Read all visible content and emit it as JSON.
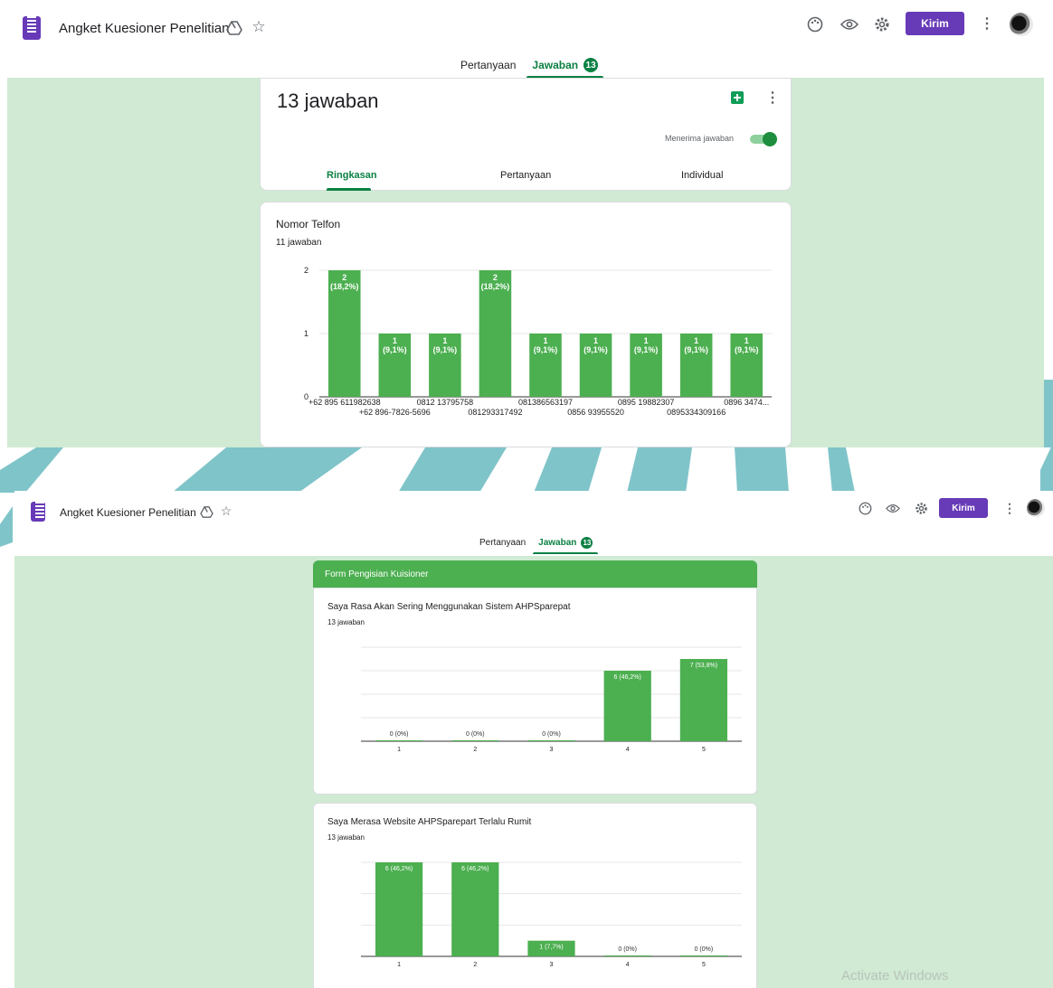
{
  "top": {
    "title": "Angket Kuesioner Penelitian",
    "send_label": "Kirim",
    "tabs": [
      {
        "label": "Pertanyaan"
      },
      {
        "label": "Jawaban"
      }
    ],
    "response_badge": "13",
    "summary_card": {
      "count_label": "13 jawaban",
      "accepting_label": "Menerima jawaban",
      "subtabs": [
        {
          "label": "Ringkasan"
        },
        {
          "label": "Pertanyaan"
        },
        {
          "label": "Individual"
        }
      ]
    }
  },
  "bottom": {
    "title": "Angket Kuesioner Penelitian",
    "send_label": "Kirim",
    "tabs": [
      {
        "label": "Pertanyaan"
      },
      {
        "label": "Jawaban"
      }
    ],
    "response_badge": "13",
    "section_title": "Form Pengisian Kuisioner"
  },
  "questions": [
    {
      "title": "Nomor Telfon",
      "responses": "11 jawaban"
    },
    {
      "title": "Saya Rasa Akan Sering Menggunakan Sistem AHPSparepat",
      "responses": "13 jawaban"
    },
    {
      "title": "Saya Merasa Website AHPSparepart Terlalu Rumit",
      "responses": "13 jawaban"
    }
  ],
  "chart_data": [
    {
      "type": "bar",
      "categories": [
        "+62 895 611982638",
        "+62 896-7826-5696",
        "0812 13795758",
        "081293317492",
        "081386563197",
        "0856 93955520",
        "0895 19882307",
        "0895334309166",
        "0896 3474..."
      ],
      "values": [
        2,
        1,
        1,
        2,
        1,
        1,
        1,
        1,
        1
      ],
      "data_labels": [
        "2\n(18,2%)",
        "1\n(9,1%)",
        "1\n(9,1%)",
        "2\n(18,2%)",
        "1\n(9,1%)",
        "1\n(9,1%)",
        "1\n(9,1%)",
        "1\n(9,1%)",
        "1\n(9,1%)"
      ],
      "yticks": [
        "0",
        "1",
        "2"
      ],
      "ylim": [
        0,
        2
      ],
      "grid": true
    },
    {
      "type": "bar",
      "categories": [
        "1",
        "2",
        "3",
        "4",
        "5"
      ],
      "values": [
        0,
        0,
        0,
        6,
        7
      ],
      "data_labels": [
        "0 (0%)",
        "0 (0%)",
        "0 (0%)",
        "6 (46,2%)",
        "7 (53,8%)"
      ],
      "yticks": [
        "0",
        "2",
        "4",
        "6",
        "8"
      ],
      "ylim": [
        0,
        8
      ],
      "grid": true
    },
    {
      "type": "bar",
      "categories": [
        "1",
        "2",
        "3",
        "4",
        "5"
      ],
      "values": [
        6,
        6,
        1,
        0,
        0
      ],
      "data_labels": [
        "6 (46,2%)",
        "6 (46,2%)",
        "1 (7,7%)",
        "0 (0%)",
        "0 (0%)"
      ],
      "yticks": [
        "0",
        "2",
        "4",
        "6"
      ],
      "ylim": [
        0,
        6
      ],
      "grid": true
    }
  ],
  "colors": {
    "bar": "#4caf50",
    "brand": "#673ab7",
    "accent": "#0b8043",
    "panel": "#d0ead3"
  },
  "overlay": {
    "watermark": "Activate Windows"
  }
}
